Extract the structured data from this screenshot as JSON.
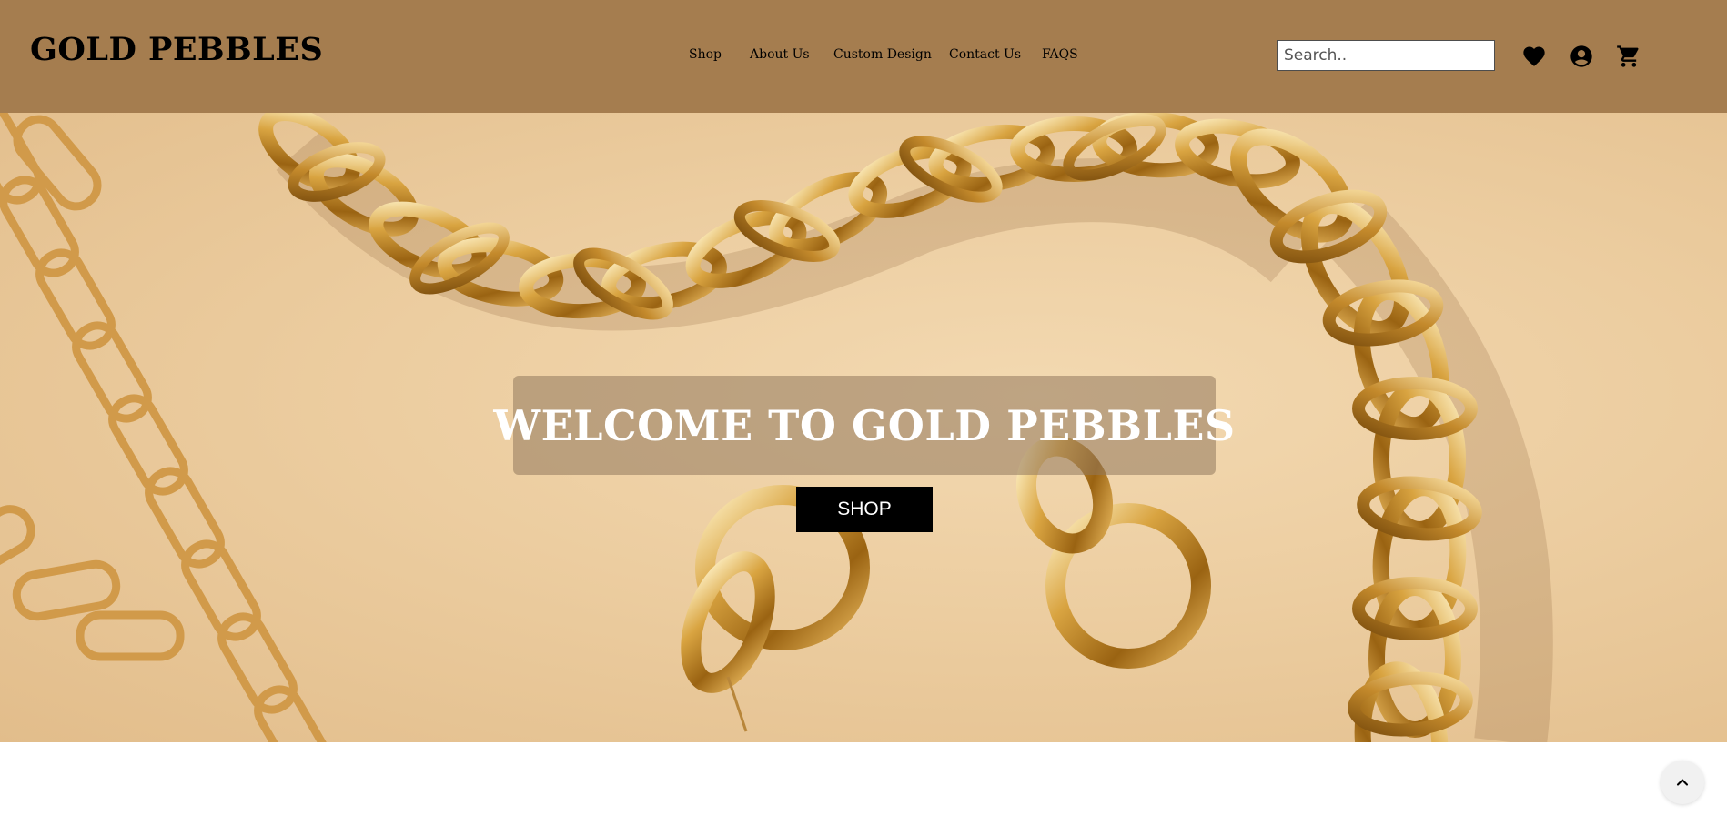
{
  "header": {
    "logo": "GOLD PEBBLES",
    "nav": [
      {
        "label": "Shop"
      },
      {
        "label": "About Us"
      },
      {
        "label": "Custom Design"
      },
      {
        "label": "Contact Us"
      },
      {
        "label": "FAQS"
      }
    ],
    "search": {
      "placeholder": "Search..",
      "value": ""
    },
    "icons": [
      "heart-icon",
      "account-icon",
      "cart-icon"
    ]
  },
  "hero": {
    "title": "WELCOME TO GOLD PEBBLES",
    "button": "SHOP"
  },
  "colors": {
    "header_bg": "#a57d4f",
    "button_bg": "#000000",
    "overlay": "rgba(145,120,92,0.55)"
  }
}
